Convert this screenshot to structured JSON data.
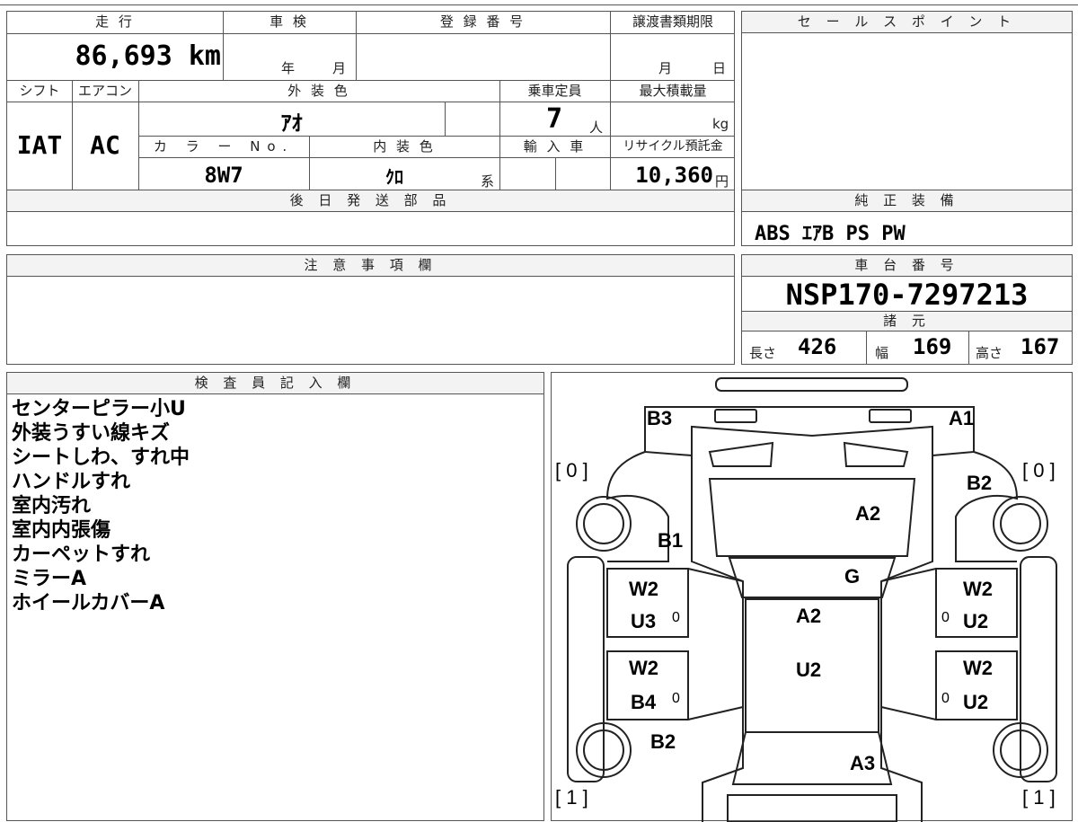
{
  "labels": {
    "mileage": "走 行",
    "inspection": "車 検",
    "registration": "登 録 番 号",
    "transfer_deadline": "譲渡書類期限",
    "sales_point": "セ ー ル ス ポ イ ン ト",
    "shift": "シフト",
    "aircon": "エアコン",
    "exterior_color": "外 装 色",
    "capacity": "乗車定員",
    "max_load": "最大積載量",
    "color_no": "カ ラ ー No.",
    "interior_color": "内 装 色",
    "import": "輸 入 車",
    "recycle": "リサイクル預託金",
    "later_parts": "後 日 発 送 部 品",
    "genuine_equipment": "純 正 装 備",
    "caution": "注 意 事 項 欄",
    "chassis_no": "車 台 番 号",
    "specs": "諸 元",
    "inspector": "検 査 員 記 入 欄",
    "year": "年",
    "month": "月",
    "day": "日",
    "persons": "人",
    "kg": "kg",
    "yen": "円",
    "kei": "系",
    "length": "長さ",
    "width": "幅",
    "height": "高さ"
  },
  "values": {
    "mileage": "86,693 km",
    "shift": "IAT",
    "aircon": "AC",
    "exterior_color": "ｱｵ",
    "capacity": "7",
    "color_no": "8W7",
    "interior_color": "ｸﾛ",
    "recycle": "10,360",
    "genuine_equipment": "ABS ｴｱB PS PW",
    "chassis_no": "NSP170-7297213",
    "length": "426",
    "width": "169",
    "height": "167"
  },
  "inspector_notes": [
    "センターピラー小U",
    "外装うすい線キズ",
    "シートしわ、すれ中",
    "ハンドルすれ",
    "室内汚れ",
    "室内内張傷",
    "カーペットすれ",
    "ミラーA",
    "ホイールカバーA"
  ],
  "diagram": {
    "tire_fl": "[ 0 ]",
    "tire_fr": "[ 0 ]",
    "tire_rl": "[ 1 ]",
    "tire_rr": "[ 1 ]",
    "b3": "B3",
    "a1": "A1",
    "b2_top": "B2",
    "a2_hood": "A2",
    "b1": "B1",
    "g": "G",
    "w2_lf": "W2",
    "u3": "U3",
    "a2_roof": "A2",
    "w2_rf": "W2",
    "u2_rf": "U2",
    "w2_lr": "W2",
    "b4": "B4",
    "u2_center": "U2",
    "w2_rr": "W2",
    "u2_rr": "U2",
    "b2_bottom": "B2",
    "a3": "A3",
    "zero1": "0",
    "zero2": "0",
    "zero3": "0",
    "zero4": "0"
  }
}
